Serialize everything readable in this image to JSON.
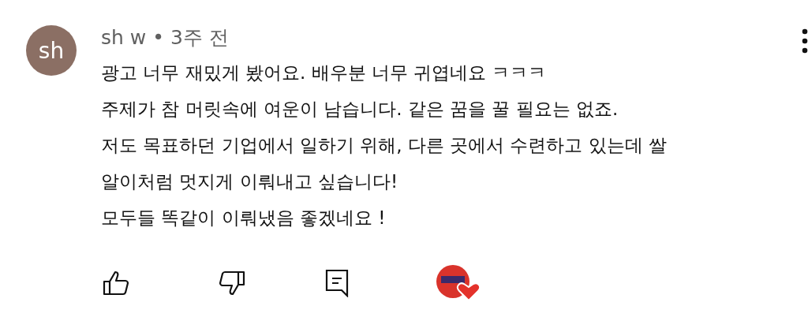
{
  "comment": {
    "avatar": "sh",
    "author": "sh w",
    "separator": "•",
    "time": "3주 전",
    "lines": [
      "광고 너무 재밌게 봤어요. 배우분 너무 귀엽네요 ㅋㅋㅋ",
      "주제가 참 머릿속에 여운이 남습니다. 같은 꿈을 꿀 필요는 없죠.",
      "저도 목표하던 기업에서 일하기 위해, 다른 곳에서 수련하고 있는데 쌀",
      "알이처럼 멋지게 이뤄내고 싶습니다!",
      "모두들 똑같이 이뤄냈음 좋겠네요 !"
    ],
    "creator_hearted": true
  }
}
